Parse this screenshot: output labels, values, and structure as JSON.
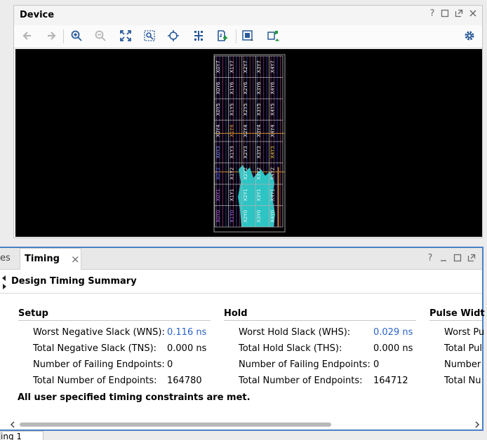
{
  "device": {
    "title": "Device",
    "controls": [
      "?",
      "□",
      "⧉",
      "✕"
    ],
    "toolbar": [
      "back",
      "forward",
      "zoom-in",
      "zoom-out",
      "zoom-fit",
      "zoom-selection",
      "center",
      "route",
      "place",
      "highlight",
      "options"
    ],
    "clock_regions": [
      [
        "X0Y7",
        "X1Y7",
        "X2Y7",
        "X3Y7",
        "X4Y7"
      ],
      [
        "X0Y6",
        "X1Y6",
        "X2Y6",
        "X3Y6",
        "X4Y6"
      ],
      [
        "X0Y5",
        "X1Y5",
        "X2Y5",
        "X3Y5",
        "X4Y5"
      ],
      [
        "X0Y4",
        "X1Y4",
        "X2Y4",
        "X3Y4",
        "X4Y4"
      ],
      [
        "X0Y3",
        "X1Y3",
        "X2Y3",
        "X3Y3",
        "X4Y3"
      ],
      [
        "X0Y2",
        "X1Y2",
        "X2Y2",
        "X3Y2",
        "X4Y2"
      ],
      [
        "X0Y1",
        "X1Y1",
        "X2Y1",
        "X3Y1",
        "X4Y1"
      ],
      [
        "X0Y0",
        "X1Y0",
        "X2Y0",
        "X3Y0",
        "X4Y0"
      ]
    ],
    "accent": "#2ec4c4"
  },
  "timing": {
    "left_tab_fragment": "es",
    "tab_label": "Timing",
    "tab_close": "×",
    "controls": [
      "?",
      "—",
      "□",
      "⧉"
    ],
    "summary_title": "Design Timing Summary",
    "setup": {
      "title": "Setup",
      "rows": [
        {
          "label": "Worst Negative Slack (WNS):",
          "value": "0.116 ns",
          "link": true
        },
        {
          "label": "Total Negative Slack (TNS):",
          "value": "0.000 ns",
          "link": false
        },
        {
          "label": "Number of Failing Endpoints:",
          "value": "0",
          "link": false
        },
        {
          "label": "Total Number of Endpoints:",
          "value": "164780",
          "link": false
        }
      ]
    },
    "hold": {
      "title": "Hold",
      "rows": [
        {
          "label": "Worst Hold Slack (WHS):",
          "value": "0.029 ns",
          "link": true
        },
        {
          "label": "Total Hold Slack (THS):",
          "value": "0.000 ns",
          "link": false
        },
        {
          "label": "Number of Failing Endpoints:",
          "value": "0",
          "link": false
        },
        {
          "label": "Total Number of Endpoints:",
          "value": "164712",
          "link": false
        }
      ]
    },
    "pulse": {
      "title": "Pulse Widt",
      "rows": [
        "Worst Pu",
        "Total Pul",
        "Number ",
        "Total Nu"
      ]
    },
    "status_message": "All user specified timing constraints are met."
  },
  "bottom_tab": "ing 1"
}
